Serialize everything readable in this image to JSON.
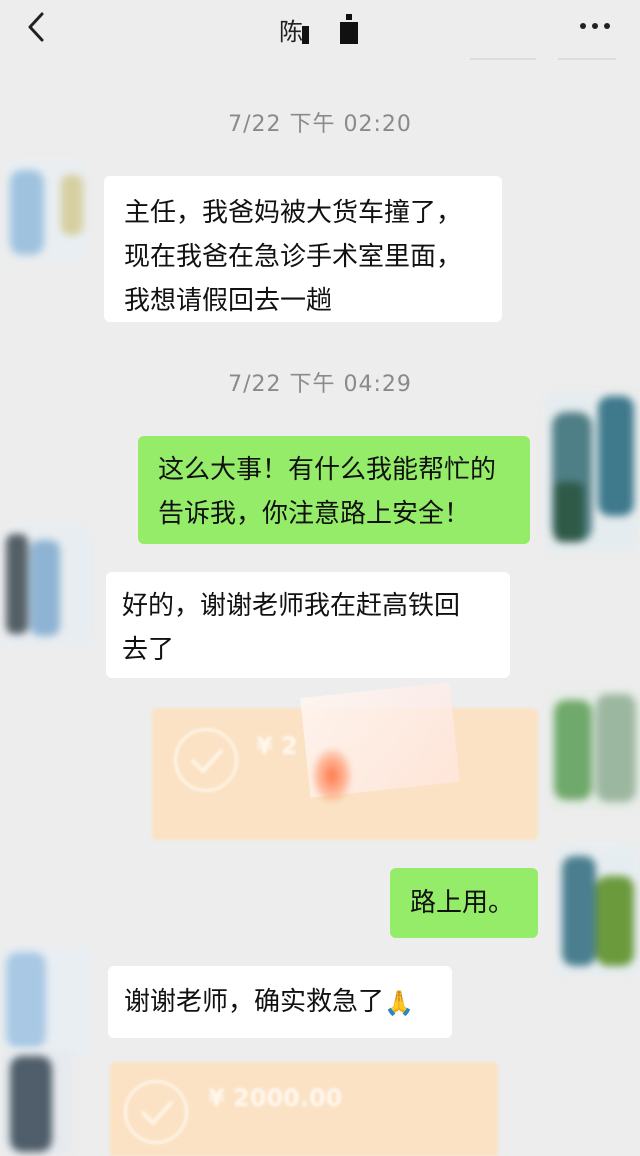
{
  "header": {
    "title": "陈",
    "back_icon": "chevron-left-icon",
    "more_icon": "more-dots-icon"
  },
  "messages": {
    "time1": "7/22 下午 02:20",
    "m1_lines": [
      "主任，我爸妈被大货车撞了，",
      "现在我爸在急诊手术室里面，",
      "我想请假回去一趟"
    ],
    "time2": "7/22 下午 04:29",
    "m2_lines": [
      "这么大事！有什么我能帮忙的",
      "告诉我，你注意路上安全！"
    ],
    "m3_lines": [
      "好的，谢谢老师我在赶高铁回",
      "去了"
    ],
    "transfer1_amount": "¥ 2",
    "m4": "路上用。",
    "m5": "谢谢老师，确实救急了",
    "m5_emoji": "🙏",
    "transfer2_amount": "¥ 2000.00"
  },
  "colors": {
    "bg": "#ededed",
    "incoming": "#ffffff",
    "outgoing": "#95ec69",
    "transfer": "#fbe2c4"
  }
}
